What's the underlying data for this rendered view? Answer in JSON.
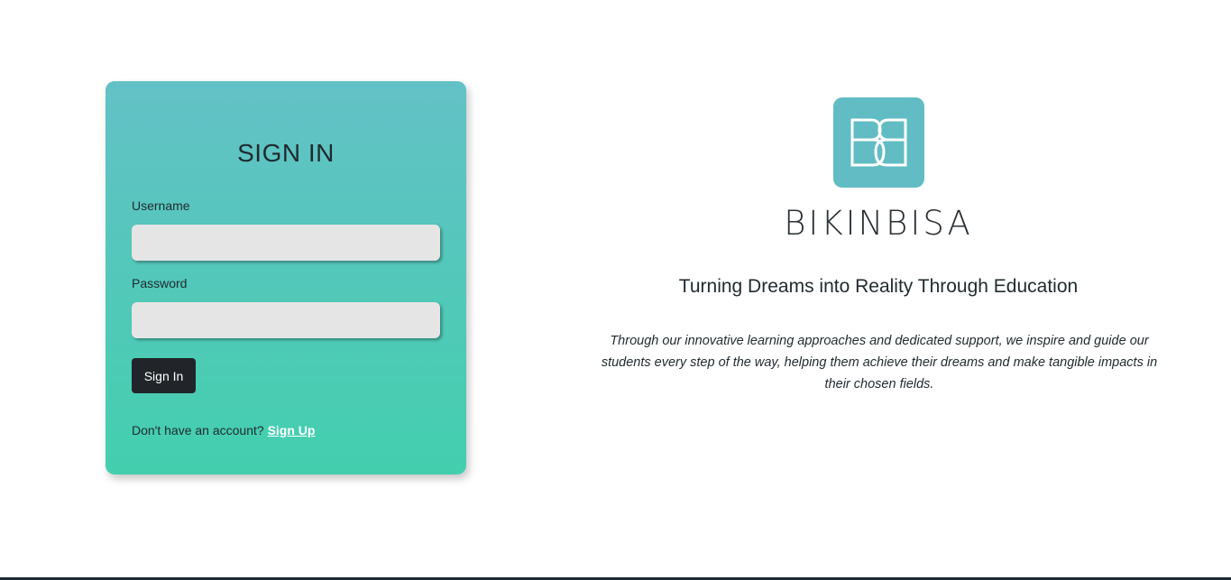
{
  "signin": {
    "title": "SIGN IN",
    "username_label": "Username",
    "username_value": "",
    "password_label": "Password",
    "password_value": "",
    "button_label": "Sign In",
    "no_account_text": "Don't have an account?",
    "signup_link": "Sign Up"
  },
  "brand": {
    "logo_letters": "BB",
    "name": "BIKINBISA",
    "tagline": "Turning Dreams into Reality Through Education",
    "description": "Through our innovative learning approaches and dedicated support, we inspire and guide our students every step of the way, helping them achieve their dreams and make tangible impacts in their chosen fields.",
    "logo_color": "#61bcc4"
  },
  "colors": {
    "card_gradient_top": "#63c1c6",
    "card_gradient_bottom": "#43cfae",
    "button_bg": "#212529",
    "input_bg": "#e5e5e6"
  }
}
